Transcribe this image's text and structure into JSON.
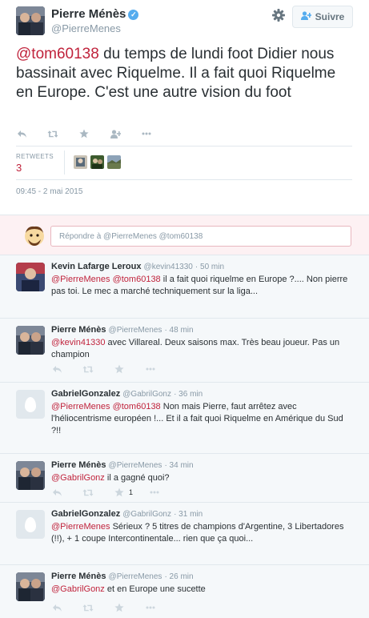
{
  "tweet": {
    "author": "Pierre Ménès",
    "verified_icon": "✓",
    "handle": "@PierreMenes",
    "follow_label": "Suivre",
    "mention": "@tom60138",
    "body": " du temps de lundi foot Didier nous bassinait avec Riquelme. Il a fait quoi Riquelme en Europe. C'est une autre vision du foot",
    "retweets_label": "RETWEETS",
    "retweets_count": "3",
    "timestamp": "09:45 - 2 mai 2015"
  },
  "icons": {
    "reply": "reply-icon",
    "retweet": "retweet-icon",
    "favorite": "star-icon",
    "follow": "follow-user-icon",
    "more": "more-icon",
    "settings": "gear-icon",
    "verified": "verified-badge-icon"
  },
  "reply_box": {
    "placeholder": "Répondre à @PierreMenes @tom60138"
  },
  "replies": [
    {
      "name": "Kevin Lafarge Leroux",
      "handle": "@kevin41330",
      "time": "· 50 min",
      "mentions": "@PierreMenes @tom60138",
      "text": " il a fait quoi riquelme en Europe ?.... Non pierre pas toi. Le mec a marché techniquement sur la liga...",
      "retweet_count": ""
    },
    {
      "name": "Pierre Ménès",
      "handle": "@PierreMenes",
      "time": "· 48 min",
      "mentions": "@kevin41330",
      "text": " avec Villareal. Deux saisons max. Très beau joueur. Pas un champion",
      "retweet_count": ""
    },
    {
      "name": "GabrielGonzalez",
      "handle": "@GabrilGonz",
      "time": "· 36 min",
      "mentions": "@PierreMenes @tom60138",
      "text": " Non mais Pierre, faut arrêtez avec l'héliocentrisme européen !... Et il a fait quoi Riquelme en Amérique du Sud ?!!",
      "retweet_count": ""
    },
    {
      "name": "Pierre Ménès",
      "handle": "@PierreMenes",
      "time": "· 34 min",
      "mentions": "@GabrilGonz",
      "text": " il a gagné quoi?",
      "retweet_count": "1"
    },
    {
      "name": "GabrielGonzalez",
      "handle": "@GabrilGonz",
      "time": "· 31 min",
      "mentions": "@PierreMenes",
      "text": " Sérieux ? 5 titres de champions d'Argentine, 3 Libertadores (!!), + 1 coupe Intercontinentale... rien que ça quoi...",
      "retweet_count": ""
    },
    {
      "name": "Pierre Ménès",
      "handle": "@PierreMenes",
      "time": "· 26 min",
      "mentions": "@GabrilGonz",
      "text": " et en Europe une sucette",
      "retweet_count": ""
    }
  ]
}
